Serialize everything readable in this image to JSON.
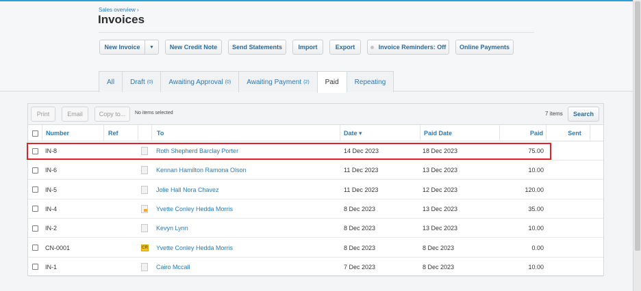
{
  "breadcrumb": "Sales overview ›",
  "title": "Invoices",
  "toolbar": {
    "new_invoice": "New Invoice",
    "new_credit_note": "New Credit Note",
    "send_statements": "Send Statements",
    "import": "Import",
    "export": "Export",
    "invoice_reminders": "Invoice Reminders: Off",
    "online_payments": "Online Payments"
  },
  "tabs": [
    {
      "label": "All",
      "count": ""
    },
    {
      "label": "Draft",
      "count": "(0)"
    },
    {
      "label": "Awaiting Approval",
      "count": "(0)"
    },
    {
      "label": "Awaiting Payment",
      "count": "(2)"
    },
    {
      "label": "Paid",
      "count": ""
    },
    {
      "label": "Repeating",
      "count": ""
    }
  ],
  "list_toolbar": {
    "print": "Print",
    "email": "Email",
    "copy_to": "Copy to...",
    "no_items_selected": "No items selected",
    "items_count": "7 items",
    "search": "Search"
  },
  "columns": {
    "number": "Number",
    "ref": "Ref",
    "to": "To",
    "date": "Date ▾",
    "paid_date": "Paid Date",
    "paid": "Paid",
    "sent": "Sent"
  },
  "rows": [
    {
      "number": "IN-8",
      "ref": "",
      "icon": "document-icon",
      "to": "Roth Shepherd Barclay Porter",
      "date": "14 Dec 2023",
      "paid_date": "18 Dec 2023",
      "paid": "75.00"
    },
    {
      "number": "IN-6",
      "ref": "",
      "icon": "document-icon",
      "to": "Kennan Hamilton Ramona Olson",
      "date": "11 Dec 2023",
      "paid_date": "13 Dec 2023",
      "paid": "10.00"
    },
    {
      "number": "IN-5",
      "ref": "",
      "icon": "document-icon",
      "to": "Jolie Hall Nora Chavez",
      "date": "11 Dec 2023",
      "paid_date": "12 Dec 2023",
      "paid": "120.00"
    },
    {
      "number": "IN-4",
      "ref": "",
      "icon": "partial-payment-document-icon",
      "to": "Yvette Conley Hedda Morris",
      "date": "8 Dec 2023",
      "paid_date": "13 Dec 2023",
      "paid": "35.00"
    },
    {
      "number": "IN-2",
      "ref": "",
      "icon": "document-icon",
      "to": "Kevyn Lynn",
      "date": "8 Dec 2023",
      "paid_date": "13 Dec 2023",
      "paid": "10.00"
    },
    {
      "number": "CN-0001",
      "ref": "",
      "icon": "credit-note-icon",
      "to": "Yvette Conley Hedda Morris",
      "date": "8 Dec 2023",
      "paid_date": "8 Dec 2023",
      "paid": "0.00"
    },
    {
      "number": "IN-1",
      "ref": "",
      "icon": "document-icon",
      "to": "Cairo Mccall",
      "date": "7 Dec 2023",
      "paid_date": "8 Dec 2023",
      "paid": "10.00"
    }
  ],
  "colors": {
    "accent": "#2a7ab8",
    "highlight": "#e0202b",
    "top_bar": "#2aa0d8"
  }
}
